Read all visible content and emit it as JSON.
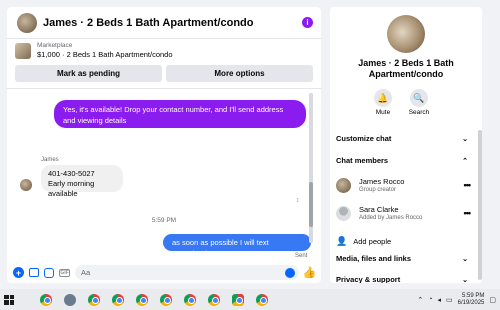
{
  "chat": {
    "title": "James · 2 Beds 1 Bath Apartment/condo",
    "marketplace_label": "Marketplace",
    "listing": "$1,000 · 2 Beds 1 Bath Apartment/condo",
    "mark_pending": "Mark as pending",
    "more_options": "More options",
    "messages": {
      "out1": "Yes, it's available! Drop your contact number, and I'll send address and viewing details",
      "sender": "James",
      "in_line1": "401-430-5027",
      "in_line2": "Early morning available",
      "timestamp": "5:59 PM",
      "out2": "as soon as possible I will text you..Thanks",
      "status": "Sent"
    },
    "composer": {
      "placeholder": "Aa",
      "gif": "GIF"
    }
  },
  "info": {
    "title": "James · 2 Beds 1 Bath Apartment/condo",
    "mute": "Mute",
    "search": "Search",
    "customize": "Customize chat",
    "members_heading": "Chat members",
    "members": [
      {
        "name": "James Rocco",
        "role": "Group creator"
      },
      {
        "name": "Sara Clarke",
        "role": "Added by James Rocco"
      }
    ],
    "add_people": "Add people",
    "media": "Media, files and links",
    "privacy": "Privacy & support"
  },
  "taskbar": {
    "time": "5:59 PM",
    "date": "6/19/2025"
  },
  "colors": {
    "purple": "#8b1cf0",
    "blue": "#3878f2",
    "accent": "#0866ff"
  }
}
